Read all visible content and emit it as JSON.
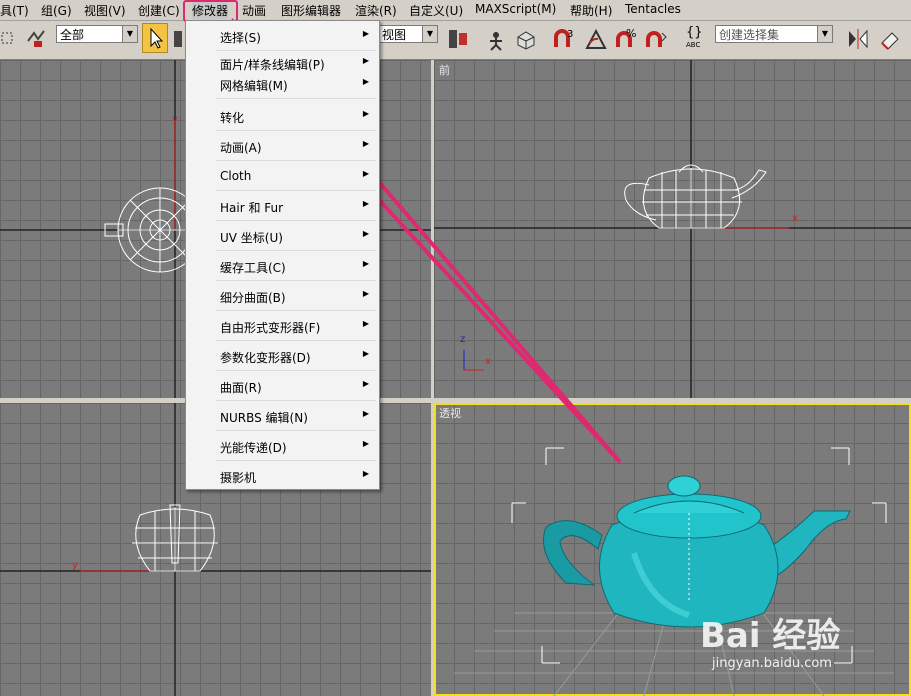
{
  "menubar": {
    "items": [
      "具(T)",
      "组(G)",
      "视图(V)",
      "创建(C)",
      "修改器",
      "动画",
      "图形编辑器",
      "渲染(R)",
      "自定义(U)",
      "MAXScript(M)",
      "帮助(H)",
      "Tentacles"
    ]
  },
  "toolbar": {
    "filter_value": "全部",
    "view_value": "视图",
    "selection_set_placeholder": "创建选择集",
    "snap_3": "3",
    "snap_percent": "%",
    "abc": "ABC",
    "brace": "{}"
  },
  "viewports": {
    "front_label": "前",
    "perspective_label": "透视",
    "axis_x": "x",
    "axis_y": "y",
    "axis_z": "z"
  },
  "dropdown": {
    "items": [
      {
        "label": "选择(S)",
        "submenu": true
      },
      {
        "label": "面片/样条线编辑(P)",
        "submenu": true
      },
      {
        "label": "网格编辑(M)",
        "submenu": true
      },
      {
        "label": "转化",
        "submenu": true
      },
      {
        "label": "动画(A)",
        "submenu": true
      },
      {
        "label": "Cloth",
        "submenu": true
      },
      {
        "label": "Hair 和 Fur",
        "submenu": true
      },
      {
        "label": "UV 坐标(U)",
        "submenu": true
      },
      {
        "label": "缓存工具(C)",
        "submenu": true
      },
      {
        "label": "细分曲面(B)",
        "submenu": true
      },
      {
        "label": "自由形式变形器(F)",
        "submenu": true
      },
      {
        "label": "参数化变形器(D)",
        "submenu": true
      },
      {
        "label": "曲面(R)",
        "submenu": true
      },
      {
        "label": "NURBS 编辑(N)",
        "submenu": true
      },
      {
        "label": "光能传递(D)",
        "submenu": true
      },
      {
        "label": "摄影机",
        "submenu": true
      }
    ],
    "submenu_glyph": "▶"
  },
  "annotation": {
    "color": "#e02870"
  },
  "watermark": {
    "brand": "Bai 经验",
    "url": "jingyan.baidu.com"
  },
  "colors": {
    "teapot": "#1fb6bf",
    "wire": "#ffffff",
    "active_border": "#f0e020",
    "axis_red": "#d02020"
  }
}
